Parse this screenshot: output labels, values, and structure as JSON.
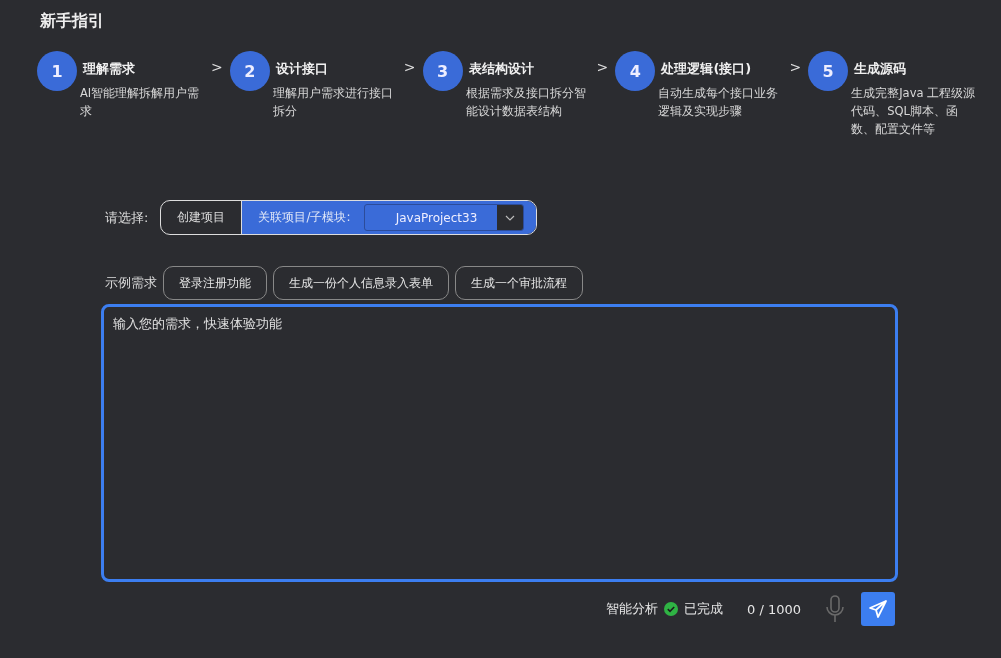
{
  "title": "新手指引",
  "steps": [
    {
      "number": "1",
      "title": "理解需求",
      "description": "AI智能理解拆解用户需求"
    },
    {
      "number": "2",
      "title": "设计接口",
      "description": "理解用户需求进行接口拆分"
    },
    {
      "number": "3",
      "title": "表结构设计",
      "description": "根据需求及接口拆分智能设计数据表结构"
    },
    {
      "number": "4",
      "title": "处理逻辑(接口)",
      "description": "自动生成每个接口业务逻辑及实现步骤"
    },
    {
      "number": "5",
      "title": "生成源码",
      "description": "生成完整Java 工程级源代码、SQL脚本、函数、配置文件等"
    }
  ],
  "separator": ">",
  "choose": {
    "label": "请选择:",
    "segments": [
      {
        "label": "创建项目",
        "selected": false
      },
      {
        "label": "关联项目/子模块:",
        "selected": true
      }
    ],
    "project_select": {
      "value": "JavaProject33"
    }
  },
  "examples": {
    "label": "示例需求",
    "items": [
      "登录注册功能",
      "生成一份个人信息录入表单",
      "生成一个审批流程"
    ]
  },
  "input": {
    "placeholder": "输入您的需求，快速体验功能"
  },
  "footer": {
    "analysis_label": "智能分析",
    "status": "已完成",
    "done": true,
    "counter": "0 / 1000"
  }
}
